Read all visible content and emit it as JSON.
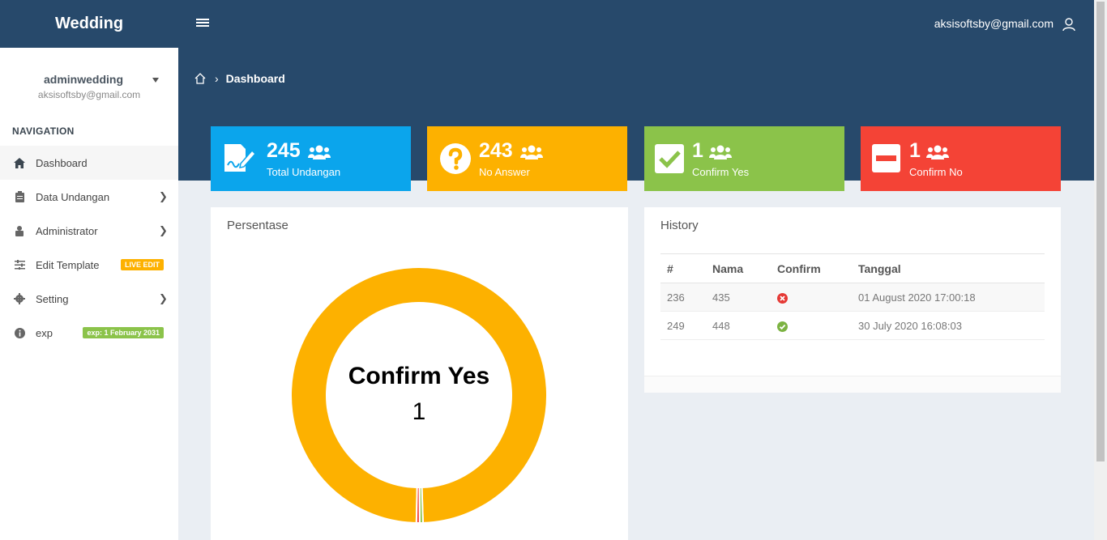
{
  "app": {
    "brand": "Wedding",
    "user_email": "aksisoftsby@gmail.com"
  },
  "breadcrumb": {
    "current": "Dashboard"
  },
  "sidebar": {
    "profile_name": "adminwedding",
    "profile_email": "aksisoftsby@gmail.com",
    "nav_title": "NAVIGATION",
    "items": [
      {
        "label": "Dashboard",
        "icon": "home-icon"
      },
      {
        "label": "Data Undangan",
        "icon": "clipboard-icon"
      },
      {
        "label": "Administrator",
        "icon": "user-lock-icon"
      },
      {
        "label": "Edit Template",
        "icon": "sliders-icon",
        "badge": "LIVE EDIT"
      },
      {
        "label": "Setting",
        "icon": "gear-icon"
      },
      {
        "label": "exp",
        "icon": "info-icon",
        "badge": "exp: 1 February 2031"
      }
    ]
  },
  "cards": [
    {
      "value": "245",
      "label": "Total Undangan",
      "color": "#0ba5ec",
      "icon": "signature-icon"
    },
    {
      "value": "243",
      "label": "No Answer",
      "color": "#fdb100",
      "icon": "question-icon"
    },
    {
      "value": "1",
      "label": "Confirm Yes",
      "color": "#8bc34a",
      "icon": "check-square-icon"
    },
    {
      "value": "1",
      "label": "Confirm No",
      "color": "#f44336",
      "icon": "minus-square-icon"
    }
  ],
  "persentase": {
    "title": "Persentase",
    "center_label": "Confirm Yes",
    "center_value": "1"
  },
  "chart_data": {
    "type": "pie",
    "categories": [
      "No Answer",
      "Confirm Yes",
      "Confirm No"
    ],
    "values": [
      243,
      1,
      1
    ],
    "colors": [
      "#fdb100",
      "#8bc34a",
      "#f44336"
    ]
  },
  "history": {
    "title": "History",
    "columns": [
      "#",
      "Nama",
      "Confirm",
      "Tanggal"
    ],
    "rows": [
      {
        "id": "236",
        "nama": "435",
        "confirm": "no",
        "tanggal": "01 August 2020 17:00:18"
      },
      {
        "id": "249",
        "nama": "448",
        "confirm": "yes",
        "tanggal": "30 July 2020 16:08:03"
      }
    ]
  }
}
